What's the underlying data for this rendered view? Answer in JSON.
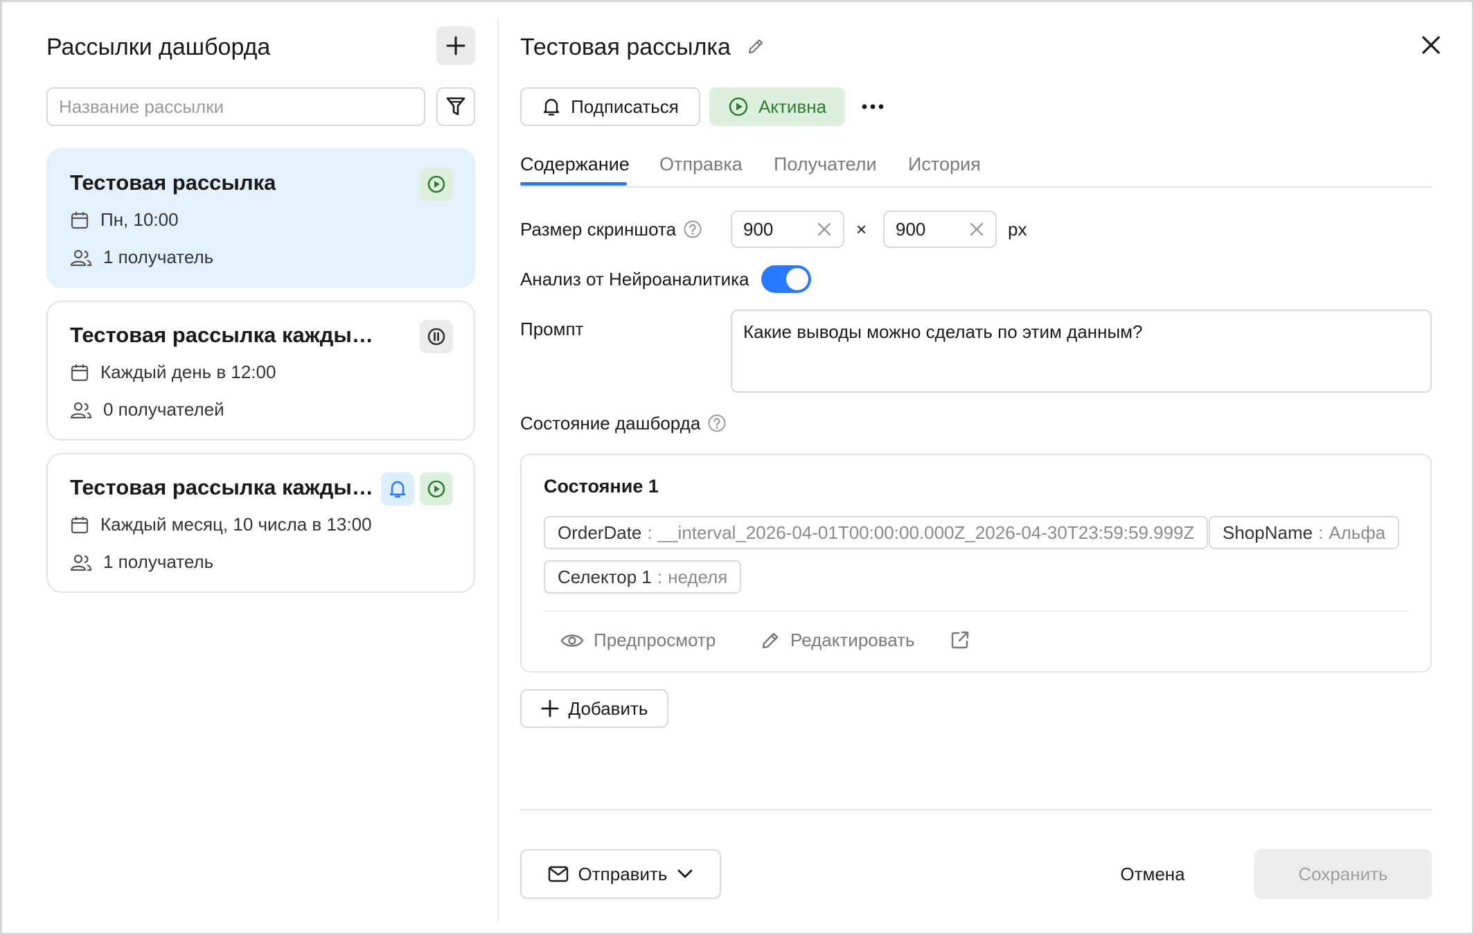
{
  "colors": {
    "accent": "#2979ff",
    "active_card_bg": "#e3f1fd",
    "active_badge_bg": "#ddf0dd",
    "active_green": "#2e7d32",
    "disabled_bg": "#ececec"
  },
  "sidebar": {
    "title": "Рассылки дашборда",
    "add_icon": "plus-icon",
    "filter_icon": "filter-icon",
    "search_placeholder": "Название рассылки",
    "items": [
      {
        "title": "Тестовая рассылка",
        "schedule": "Пн, 10:00",
        "recipients": "1 получатель",
        "status_icon": "play-circle-icon",
        "selected": true
      },
      {
        "title": "Тестовая рассылка каждый день",
        "schedule": "Каждый день в 12:00",
        "recipients": "0 получателей",
        "status_icon": "pause-circle-icon",
        "selected": false
      },
      {
        "title": "Тестовая рассылка каждый м...",
        "schedule": "Каждый месяц, 10 числа в 13:00",
        "recipients": "1 получатель",
        "status_icon": "play-circle-icon",
        "subscribed_icon": "bell-icon",
        "selected": false
      }
    ]
  },
  "detail": {
    "title": "Тестовая рассылка",
    "subscribe_label": "Подписаться",
    "status_label": "Активна",
    "tabs": [
      "Содержание",
      "Отправка",
      "Получатели",
      "История"
    ],
    "active_tab": "Содержание",
    "screenshot_size_label": "Размер скриншота",
    "width_value": "900",
    "height_value": "900",
    "times": "×",
    "unit": "px",
    "analysis_label": "Анализ от Нейроаналитика",
    "analysis_enabled": true,
    "prompt_label": "Промпт",
    "prompt_value": "Какие выводы можно сделать по этим данным?",
    "dashboard_state_label": "Состояние дашборда",
    "states": [
      {
        "title": "Состояние 1",
        "params": [
          {
            "key": "OrderDate",
            "sep": ":",
            "value": "__interval_2026-04-01T00:00:00.000Z_2026-04-30T23:59:59.999Z"
          },
          {
            "key": "ShopName",
            "sep": ":",
            "value": "Альфа"
          },
          {
            "key": "Селектор 1",
            "sep": ":",
            "value": "неделя"
          }
        ],
        "preview_label": "Предпросмотр",
        "edit_label": "Редактировать"
      }
    ],
    "add_label": "Добавить",
    "send_label": "Отправить",
    "cancel_label": "Отмена",
    "save_label": "Сохранить"
  }
}
